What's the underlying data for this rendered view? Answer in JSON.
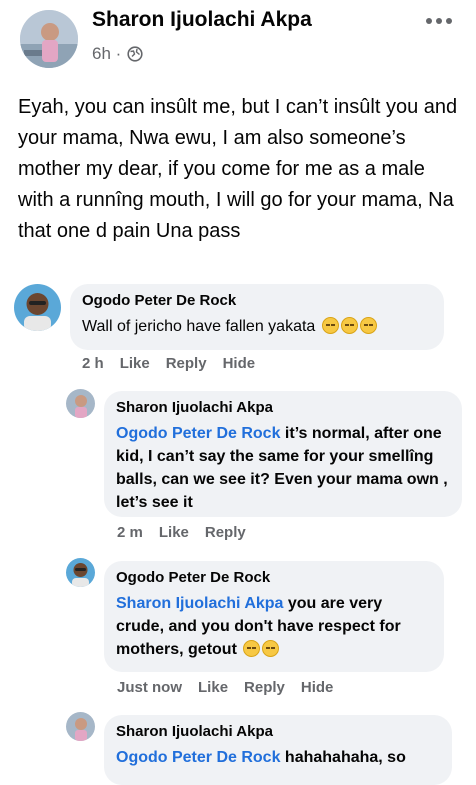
{
  "post": {
    "author": "Sharon Ijuolachi Akpa",
    "time": "6h ·",
    "text": "Eyah, you can insûlt me, but I can’t insûlt you and your mama, Nwa ewu, I am also someone’s mother my dear, if you come for me as a male with a runnîng mouth, I will go for your mama, Na that one d pain Una pass"
  },
  "comments": [
    {
      "name": "Ogodo Peter De Rock",
      "mention": "",
      "text": "Wall of jericho have fallen yakata",
      "emoji": [
        "hushed-face",
        "smirk-face",
        "relieved-face"
      ],
      "time": "2 h",
      "actions": [
        "Like",
        "Reply",
        "Hide"
      ]
    },
    {
      "name": "Sharon Ijuolachi Akpa",
      "mention": "Ogodo Peter De Rock",
      "text": " it’s normal, after one kid, I can’t say the same for your smellîng balls, can we see it? Even your mama own , let’s see it",
      "time": "2 m",
      "actions": [
        "Like",
        "Reply"
      ]
    },
    {
      "name": "Ogodo Peter De Rock",
      "mention": "Sharon Ijuolachi Akpa",
      "text": " you are very crude, and you don't have respect for mothers, getout",
      "emoji": [
        "smirk-face",
        "relieved-face"
      ],
      "time": "Just now",
      "actions": [
        "Like",
        "Reply",
        "Hide"
      ]
    },
    {
      "name": "Sharon Ijuolachi Akpa",
      "mention": "Ogodo Peter De Rock",
      "text": " hahahahaha, so"
    }
  ],
  "colors": {
    "mention": "#216fdb",
    "bubble": "#f0f2f5",
    "meta": "#65676b"
  }
}
